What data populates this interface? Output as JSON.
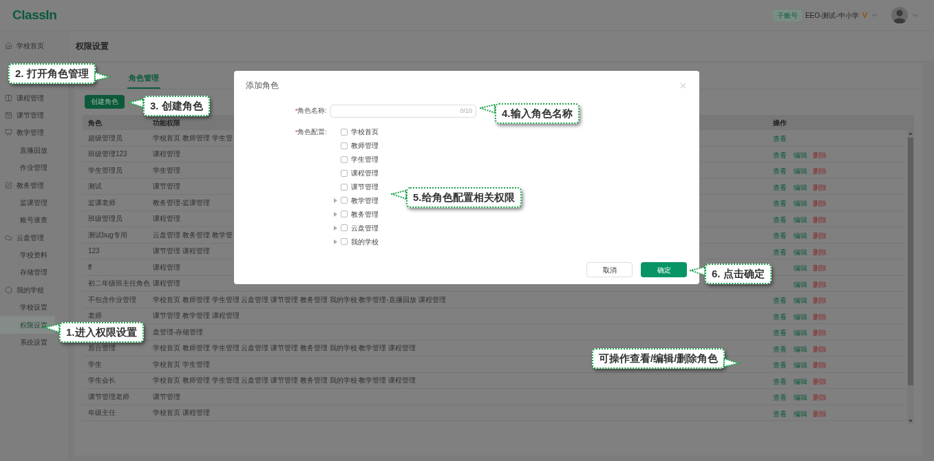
{
  "header": {
    "logo": "ClassIn",
    "account_badge": "子账号",
    "school": "EEO-测试-中小学",
    "vip_mark": "V"
  },
  "sidebar": {
    "items": [
      {
        "label": "学校首页",
        "kind": "group",
        "selected": false
      },
      {
        "label": "课程管理",
        "kind": "group",
        "selected": false
      },
      {
        "label": "课节管理",
        "kind": "group",
        "selected": false
      },
      {
        "label": "教学管理",
        "kind": "group",
        "selected": false
      },
      {
        "label": "直播回放",
        "kind": "sub",
        "selected": false
      },
      {
        "label": "作业管理",
        "kind": "sub",
        "selected": false
      },
      {
        "label": "教务管理",
        "kind": "group",
        "selected": false
      },
      {
        "label": "监课管理",
        "kind": "sub",
        "selected": false
      },
      {
        "label": "账号速查",
        "kind": "sub",
        "selected": false
      },
      {
        "label": "云盘管理",
        "kind": "group",
        "selected": false
      },
      {
        "label": "学校资料",
        "kind": "sub",
        "selected": false
      },
      {
        "label": "存储管理",
        "kind": "sub",
        "selected": false
      },
      {
        "label": "我的学校",
        "kind": "group",
        "selected": false
      },
      {
        "label": "学校设置",
        "kind": "sub",
        "selected": false
      },
      {
        "label": "权限设置",
        "kind": "sub",
        "selected": true
      },
      {
        "label": "系统设置",
        "kind": "sub",
        "selected": false
      }
    ]
  },
  "page_title": "权限设置",
  "tabs": [
    {
      "label": "角色管理",
      "selected": true
    }
  ],
  "create_button": "创建角色",
  "table": {
    "columns": [
      "角色",
      "功能权限",
      "操作"
    ],
    "rows": [
      {
        "role": "超级管理员",
        "permissions": "学校首页 教师管理 学生管",
        "actions": [
          {
            "label": "查看",
            "kind": "view"
          }
        ]
      },
      {
        "role": "班级管理123",
        "permissions": "课程管理",
        "actions": [
          {
            "label": "查看",
            "kind": "view"
          },
          {
            "label": "编辑",
            "kind": "edit"
          },
          {
            "label": "删除",
            "kind": "delete"
          }
        ]
      },
      {
        "role": "学生管理员",
        "permissions": "学生管理",
        "actions": [
          {
            "label": "查看",
            "kind": "view"
          },
          {
            "label": "编辑",
            "kind": "edit"
          },
          {
            "label": "删除",
            "kind": "delete"
          }
        ]
      },
      {
        "role": "测试",
        "permissions": "课节管理",
        "actions": [
          {
            "label": "查看",
            "kind": "view"
          },
          {
            "label": "编辑",
            "kind": "edit"
          },
          {
            "label": "删除",
            "kind": "delete"
          }
        ]
      },
      {
        "role": "监课老师",
        "permissions": "教务管理-监课管理",
        "actions": [
          {
            "label": "查看",
            "kind": "view"
          },
          {
            "label": "编辑",
            "kind": "edit"
          },
          {
            "label": "删除",
            "kind": "delete"
          }
        ]
      },
      {
        "role": "班级管理员",
        "permissions": "课程管理",
        "actions": [
          {
            "label": "查看",
            "kind": "view"
          },
          {
            "label": "编辑",
            "kind": "edit"
          },
          {
            "label": "删除",
            "kind": "delete"
          }
        ]
      },
      {
        "role": "测试bug专用",
        "permissions": "云盘管理 教务管理 教学管",
        "actions": [
          {
            "label": "查看",
            "kind": "view"
          },
          {
            "label": "编辑",
            "kind": "edit"
          },
          {
            "label": "删除",
            "kind": "delete"
          }
        ]
      },
      {
        "role": "123",
        "permissions": "课节管理 课程管理",
        "actions": [
          {
            "label": "查看",
            "kind": "view"
          },
          {
            "label": "编辑",
            "kind": "edit"
          },
          {
            "label": "删除",
            "kind": "delete"
          }
        ]
      },
      {
        "role": "ff",
        "permissions": "课程管理",
        "actions": [
          {
            "label": "编辑",
            "kind": "edit"
          },
          {
            "label": "删除",
            "kind": "delete"
          }
        ]
      },
      {
        "role": "初二年级班主任角色",
        "permissions": "课程管理",
        "actions": [
          {
            "label": "编辑",
            "kind": "edit"
          },
          {
            "label": "删除",
            "kind": "delete"
          }
        ]
      },
      {
        "role": "不包含作业管理",
        "permissions": "学校首页 教师管理 学生管理 云盘管理 课节管理 教务管理 我的学校 教学管理-直播回放 课程管理",
        "actions": [
          {
            "label": "查看",
            "kind": "view"
          },
          {
            "label": "编辑",
            "kind": "edit"
          },
          {
            "label": "删除",
            "kind": "delete"
          }
        ]
      },
      {
        "role": "老师",
        "permissions": "课节管理 教学管理 课程管理",
        "actions": [
          {
            "label": "查看",
            "kind": "view"
          },
          {
            "label": "编辑",
            "kind": "edit"
          },
          {
            "label": "删除",
            "kind": "delete"
          }
        ]
      },
      {
        "permissions": "盘管理-存储管理",
        "actions": [
          {
            "label": "查看",
            "kind": "view"
          },
          {
            "label": "编辑",
            "kind": "edit"
          },
          {
            "label": "删除",
            "kind": "delete"
          }
        ]
      },
      {
        "role": "后台管理",
        "permissions": "学校首页 教师管理 学生管理 云盘管理 课节管理 教务管理 我的学校 教学管理 课程管理",
        "actions": [
          {
            "label": "查看",
            "kind": "view"
          },
          {
            "label": "编辑",
            "kind": "edit"
          },
          {
            "label": "删除",
            "kind": "delete"
          }
        ]
      },
      {
        "role": "学生",
        "permissions": "学校首页 学生管理",
        "actions": [
          {
            "label": "查看",
            "kind": "view"
          },
          {
            "label": "编辑",
            "kind": "edit"
          },
          {
            "label": "删除",
            "kind": "delete"
          }
        ]
      },
      {
        "role": "学生会长",
        "permissions": "学校首页 教师管理 学生管理 云盘管理 课节管理 教务管理 我的学校 教学管理 课程管理",
        "actions": [
          {
            "label": "查看",
            "kind": "view"
          },
          {
            "label": "编辑",
            "kind": "edit"
          },
          {
            "label": "删除",
            "kind": "delete"
          }
        ]
      },
      {
        "role": "课节管理老师",
        "permissions": "课节管理",
        "actions": [
          {
            "label": "查看",
            "kind": "view"
          },
          {
            "label": "编辑",
            "kind": "edit"
          },
          {
            "label": "删除",
            "kind": "delete"
          }
        ]
      },
      {
        "role": "年级主任",
        "permissions": "学校首页 课程管理",
        "actions": [
          {
            "label": "查看",
            "kind": "view"
          },
          {
            "label": "编辑",
            "kind": "edit"
          },
          {
            "label": "删除",
            "kind": "delete"
          }
        ]
      }
    ]
  },
  "dialog": {
    "title": "添加角色",
    "required_mark": "*",
    "name_label": "角色名称:",
    "name_counter": "0/10",
    "config_label": "角色配置:",
    "permissions": [
      {
        "label": "学校首页",
        "kind": "leaf",
        "checked": false
      },
      {
        "label": "教师管理",
        "kind": "leaf",
        "checked": false
      },
      {
        "label": "学生管理",
        "kind": "leaf",
        "checked": false
      },
      {
        "label": "课程管理",
        "kind": "leaf",
        "checked": false
      },
      {
        "label": "课节管理",
        "kind": "leaf",
        "checked": false
      },
      {
        "label": "教学管理",
        "kind": "group",
        "checked": false
      },
      {
        "label": "教务管理",
        "kind": "group",
        "checked": false
      },
      {
        "label": "云盘管理",
        "kind": "group",
        "checked": false
      },
      {
        "label": "我的学校",
        "kind": "group",
        "checked": false
      }
    ],
    "cancel": "取消",
    "confirm": "确定"
  },
  "callouts": [
    {
      "text": "2. 打开角色管理"
    },
    {
      "text": "3. 创建角色"
    },
    {
      "text": "4.输入角色名称"
    },
    {
      "text": "5.给角色配置相关权限"
    },
    {
      "text": "6. 点击确定"
    },
    {
      "text": "1.进入权限设置"
    },
    {
      "text": "可操作查看/编辑/删除角色"
    }
  ]
}
